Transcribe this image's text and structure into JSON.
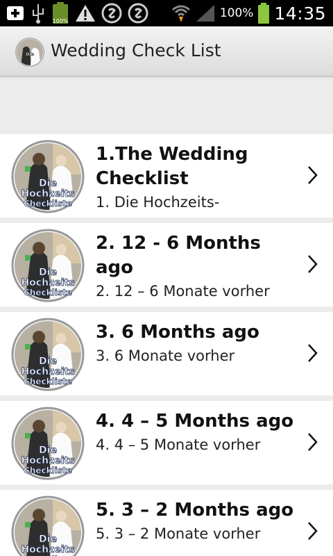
{
  "status_bar": {
    "battery_saver_label": "100%",
    "battery_percent": "100%",
    "time": "14:35"
  },
  "action_bar": {
    "title": "Wedding Check List"
  },
  "logo": {
    "line1": "Die",
    "line2": "Hochzeits",
    "line3": "Checkliste"
  },
  "items": [
    {
      "title": "1.The Wedding Checklist",
      "subtitle": "1. Die Hochzeits-"
    },
    {
      "title": "2. 12 - 6 Months ago",
      "subtitle": "2. 12 – 6 Monate vorher"
    },
    {
      "title": "3. 6 Months ago",
      "subtitle": "3. 6 Monate vorher"
    },
    {
      "title": "4. 4 – 5 Months ago",
      "subtitle": "4. 4 – 5 Monate vorher"
    },
    {
      "title": "5. 3 – 2 Months ago",
      "subtitle": "5. 3 – 2 Monate vorher"
    }
  ],
  "colors": {
    "status_bar_bg": "#000000",
    "battery_green": "#8cc63f",
    "action_bar_bg": "#e4e4e4",
    "list_bg": "#ececec",
    "row_bg": "#ffffff"
  }
}
